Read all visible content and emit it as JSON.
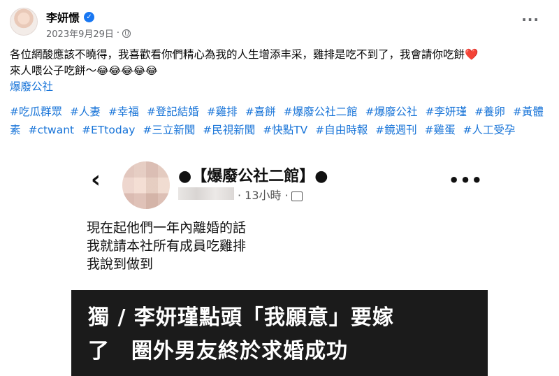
{
  "author": {
    "name": "李妍憬",
    "verified_icon": "verified-badge-icon"
  },
  "meta": {
    "date": "2023年9月29日",
    "separator": "·",
    "privacy_icon": "globe-icon"
  },
  "menu": {
    "more": "···"
  },
  "post": {
    "line1": "各位網酸應該不曉得，我喜歡看你們精心為我的人生增添丰采，雞排是吃不到了，我會請你吃餅",
    "line1_emoji": "❤️",
    "line2": "來人喂公子吃餅～",
    "line2_emoji": "😂😂😂😂😂",
    "link": "爆廢公社"
  },
  "hashtags": [
    "#吃瓜群眾",
    "#人妻",
    "#幸福",
    "#登記結婚",
    "#雞排",
    "#喜餅",
    "#爆廢公社二館",
    "#爆廢公社",
    "#李妍瑾",
    "#養卵",
    "#黃體素",
    "#ctwant",
    "#ETtoday",
    "#三立新聞",
    "#民視新聞",
    "#快點TV",
    "#自由時報",
    "#鏡週刊",
    "#雞蛋",
    "#人工受孕"
  ],
  "screenshot": {
    "back": "‹",
    "group_title": "●【爆廢公社二館】●",
    "time": "· 13小時 ·",
    "more": "•••",
    "text_lines": [
      "現在起他們一年內離婚的話",
      "我就請本社所有成員吃雞排",
      "我說到做到"
    ],
    "banner_line1": "獨 / 李妍瑾點頭「我願意」要嫁",
    "banner_line2": "了　圈外男友終於求婚成功"
  },
  "colors": {
    "link": "#1874d8",
    "verified": "#1877f2",
    "banner_bg": "#1b1b1b"
  }
}
